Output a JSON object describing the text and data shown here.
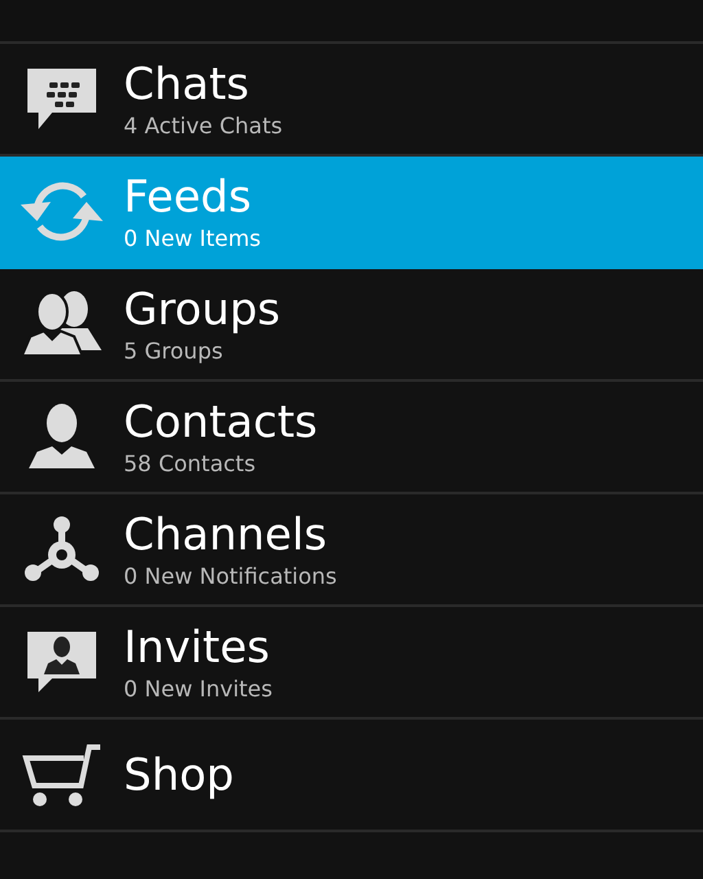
{
  "menu": [
    {
      "kind": "chats",
      "title": "Chats",
      "subtitle": "4 Active Chats",
      "selected": false
    },
    {
      "kind": "feeds",
      "title": "Feeds",
      "subtitle": "0 New Items",
      "selected": true
    },
    {
      "kind": "groups",
      "title": "Groups",
      "subtitle": "5 Groups",
      "selected": false
    },
    {
      "kind": "contacts",
      "title": "Contacts",
      "subtitle": "58 Contacts",
      "selected": false
    },
    {
      "kind": "channels",
      "title": "Channels",
      "subtitle": "0 New Notifications",
      "selected": false
    },
    {
      "kind": "invites",
      "title": "Invites",
      "subtitle": "0 New Invites",
      "selected": false
    },
    {
      "kind": "shop",
      "title": "Shop",
      "selected": false
    }
  ]
}
